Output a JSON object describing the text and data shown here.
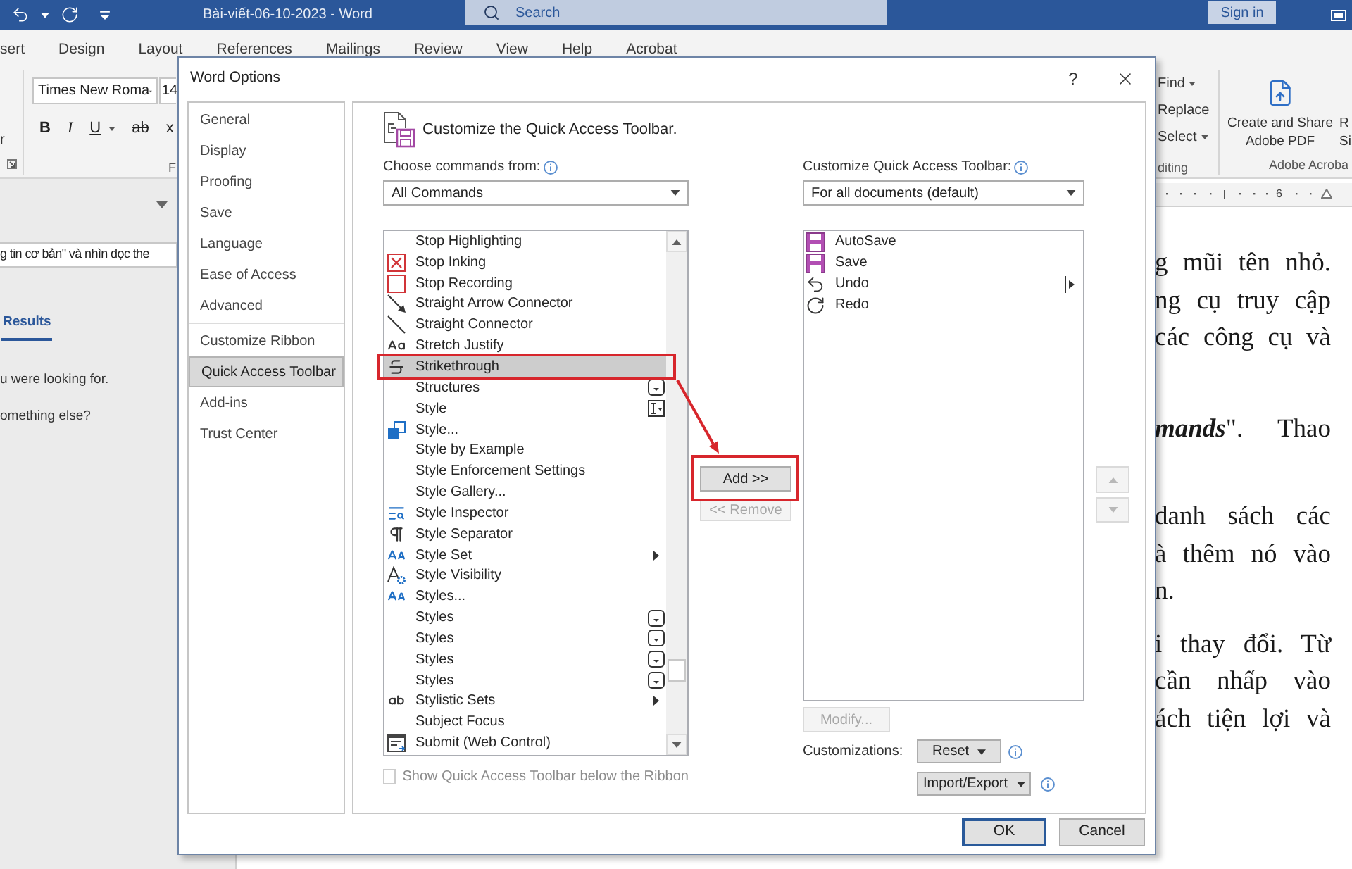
{
  "title_bar": {
    "title": "Bài-viết-06-10-2023 - Word",
    "search": {
      "placeholder": "Search"
    },
    "sign_in": "Sign in"
  },
  "ribbon_tabs": [
    "sert",
    "Design",
    "Layout",
    "References",
    "Mailings",
    "Review",
    "View",
    "Help",
    "Acrobat"
  ],
  "ribbon": {
    "clipboard_label": "r",
    "font_name": "Times New Roma",
    "font_size": "14",
    "format_buttons": [
      {
        "label": "B",
        "kind": "bold",
        "dropdown": false
      },
      {
        "label": "I",
        "kind": "italic",
        "dropdown": false
      },
      {
        "label": "U",
        "kind": "underline",
        "dropdown": true
      },
      {
        "label": "ab",
        "kind": "strikethrough",
        "dropdown": false
      },
      {
        "label": "x",
        "kind": "plain",
        "dropdown": false
      }
    ],
    "font_group_label": "F",
    "editing": {
      "items": [
        {
          "label": "Find",
          "dropdown": true
        },
        {
          "label": "Replace",
          "dropdown": false
        },
        {
          "label": "Select",
          "dropdown": true
        }
      ],
      "group_label": "diting"
    },
    "acrobat": {
      "button_lines": [
        "Create and Share",
        "Adobe PDF"
      ],
      "cut_button_lines": [
        "R",
        "Si"
      ],
      "group_label": "Adobe Acroba"
    }
  },
  "navigation_pane": {
    "search_value": "g tin cơ bản\" và nhìn dọc the",
    "results_tab": {
      "label": "Results",
      "selected": true
    },
    "messages": [
      "u were looking for.",
      "omething else?"
    ]
  },
  "ruler": {
    "label": "6"
  },
  "document": {
    "paragraphs": [
      {
        "lines": [
          {
            "text": "g mũi tên nhỏ.",
            "kind": "full"
          },
          {
            "text": "ng cụ truy cập",
            "kind": "full"
          },
          {
            "text": "các công cụ và",
            "kind": "full"
          }
        ]
      },
      {
        "lines": [
          {
            "lead": "mands",
            "text": "\". Thao",
            "kind": "full"
          }
        ]
      },
      {
        "lines": [
          {
            "text": "danh sách các",
            "kind": "full"
          },
          {
            "text": "à thêm nó vào",
            "kind": "full"
          },
          {
            "text": "n.",
            "kind": "end"
          }
        ]
      },
      {
        "lines": [
          {
            "text": "i thay đổi. Từ",
            "kind": "full"
          },
          {
            "text": "cần nhấp vào",
            "kind": "full"
          },
          {
            "text": "ách tiện lợi và",
            "kind": "full"
          }
        ]
      }
    ]
  },
  "dialog": {
    "title": "Word Options",
    "help": "?",
    "nav_groups": [
      {
        "items": [
          {
            "label": "General",
            "selected": false
          },
          {
            "label": "Display",
            "selected": false
          },
          {
            "label": "Proofing",
            "selected": false
          },
          {
            "label": "Save",
            "selected": false
          },
          {
            "label": "Language",
            "selected": false
          },
          {
            "label": "Ease of Access",
            "selected": false
          },
          {
            "label": "Advanced",
            "selected": false
          }
        ]
      },
      {
        "items": [
          {
            "label": "Customize Ribbon",
            "selected": false
          },
          {
            "label": "Quick Access Toolbar",
            "selected": true
          },
          {
            "label": "Add-ins",
            "selected": false
          },
          {
            "label": "Trust Center",
            "selected": false
          }
        ]
      }
    ],
    "heading": "Customize the Quick Access Toolbar.",
    "commands_from": {
      "label": "Choose commands from:",
      "value": "All Commands"
    },
    "commands": [
      {
        "label": "Stop Highlighting",
        "kind": "none",
        "selected": false
      },
      {
        "label": "Stop Inking",
        "kind": "cross-box",
        "selected": false
      },
      {
        "label": "Stop Recording",
        "kind": "square",
        "selected": false
      },
      {
        "label": "Straight Arrow Connector",
        "kind": "arrow-line",
        "selected": false
      },
      {
        "label": "Straight Connector",
        "kind": "line",
        "selected": false
      },
      {
        "label": "Stretch Justify",
        "kind": "text-case",
        "selected": false
      },
      {
        "label": "Strikethrough",
        "kind": "strike",
        "selected": true
      },
      {
        "label": "Structures",
        "kind": "none",
        "accessory": {
          "kind": "gallery"
        },
        "selected": false
      },
      {
        "label": "Style",
        "kind": "none",
        "accessory": {
          "kind": "cursor"
        },
        "selected": false
      },
      {
        "label": "Style...",
        "kind": "squares",
        "selected": false
      },
      {
        "label": "Style by Example",
        "kind": "none",
        "selected": false
      },
      {
        "label": "Style Enforcement Settings",
        "kind": "none",
        "selected": false
      },
      {
        "label": "Style Gallery...",
        "kind": "none",
        "selected": false
      },
      {
        "label": "Style Inspector",
        "kind": "inspector",
        "selected": false
      },
      {
        "label": "Style Separator",
        "kind": "pilcrow",
        "selected": false
      },
      {
        "label": "Style Set",
        "kind": "letters",
        "accessory": {
          "kind": "submenu"
        },
        "selected": false
      },
      {
        "label": "Style Visibility",
        "kind": "visibility",
        "selected": false
      },
      {
        "label": "Styles...",
        "kind": "letters",
        "selected": false
      },
      {
        "label": "Styles",
        "kind": "none",
        "accessory": {
          "kind": "gallery"
        },
        "selected": false
      },
      {
        "label": "Styles",
        "kind": "none",
        "accessory": {
          "kind": "gallery"
        },
        "selected": false
      },
      {
        "label": "Styles",
        "kind": "none",
        "accessory": {
          "kind": "gallery"
        },
        "selected": false
      },
      {
        "label": "Styles",
        "kind": "none",
        "accessory": {
          "kind": "gallery"
        },
        "selected": false
      },
      {
        "label": "Stylistic Sets",
        "kind": "abc",
        "accessory": {
          "kind": "submenu"
        },
        "selected": false
      },
      {
        "label": "Subject Focus",
        "kind": "none",
        "selected": false
      },
      {
        "label": "Submit (Web Control)",
        "kind": "form",
        "selected": false
      }
    ],
    "add_button": "Add >>",
    "remove_button": {
      "label": "<< Remove",
      "disabled": true
    },
    "show_below": {
      "label": "Show Quick Access Toolbar below the Ribbon",
      "checked": false,
      "disabled": true
    },
    "toolbar_for": {
      "label": "Customize Quick Access Toolbar:",
      "value": "For all documents (default)"
    },
    "toolbar_items": [
      {
        "label": "AutoSave",
        "kind": "save",
        "selected": false
      },
      {
        "label": "Save",
        "kind": "save",
        "selected": false
      },
      {
        "label": "Undo",
        "kind": "undo",
        "accessory": {
          "kind": "separator"
        },
        "selected": false
      },
      {
        "label": "Redo",
        "kind": "redo",
        "selected": false
      }
    ],
    "move_up": {
      "disabled": true
    },
    "move_down": {
      "disabled": true
    },
    "modify_button": {
      "label": "Modify...",
      "disabled": true
    },
    "customizations": {
      "label": "Customizations:",
      "reset": "Reset",
      "import_export": "Import/Export"
    },
    "ok": "OK",
    "cancel": "Cancel",
    "annotation": {
      "frame_selected_command": true,
      "frame_add_button": true,
      "arrow": true
    }
  }
}
